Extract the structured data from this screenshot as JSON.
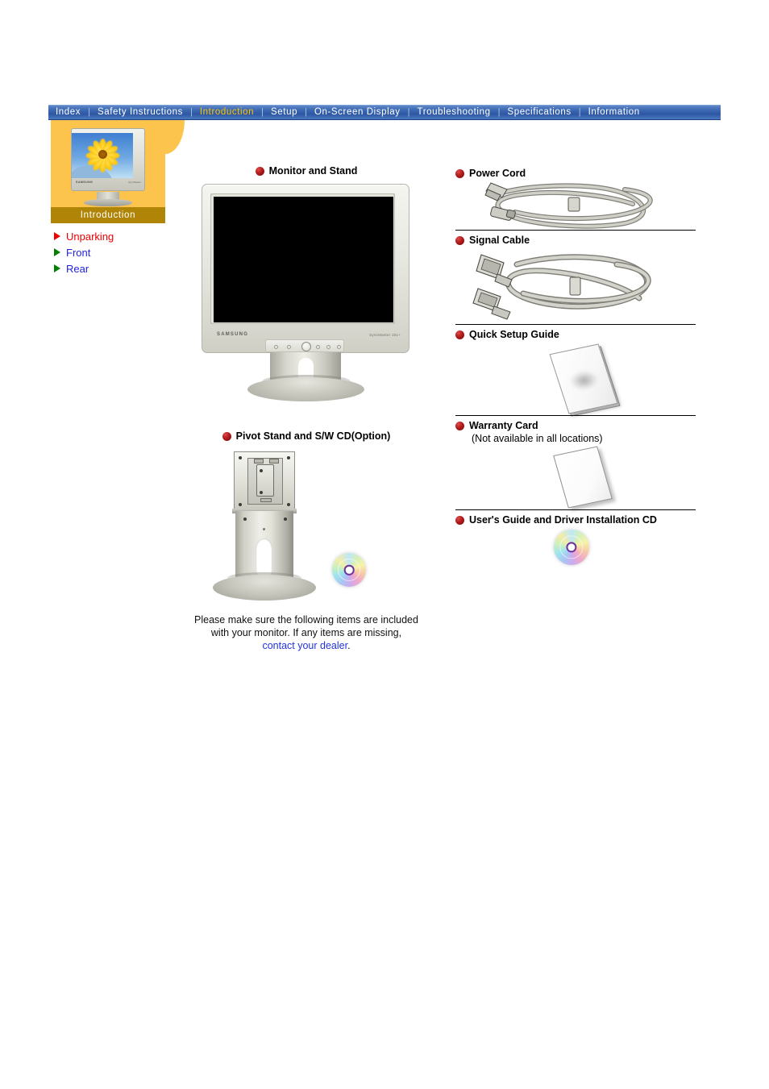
{
  "nav": {
    "separator": "|",
    "items": [
      {
        "label": "Index",
        "active": false
      },
      {
        "label": "Safety Instructions",
        "active": false
      },
      {
        "label": "Introduction",
        "active": true
      },
      {
        "label": "Setup",
        "active": false
      },
      {
        "label": "On-Screen Display",
        "active": false
      },
      {
        "label": "Troubleshooting",
        "active": false
      },
      {
        "label": "Specifications",
        "active": false
      },
      {
        "label": "Information",
        "active": false
      }
    ]
  },
  "sidebar": {
    "title": "Introduction",
    "thumbnail_logo": "SAMSUNG",
    "thumbnail_model": "SyncMaster",
    "items": [
      {
        "label": "Unparking",
        "active": true
      },
      {
        "label": "Front",
        "active": false
      },
      {
        "label": "Rear",
        "active": false
      }
    ]
  },
  "center": {
    "monitor": {
      "heading": "Monitor and Stand",
      "brand": "SAMSUNG",
      "model": "SyncMaster 151+"
    },
    "pivot": {
      "heading": "Pivot Stand and S/W CD(Option)"
    },
    "note": {
      "line1": "Please make sure the following items are included",
      "line2": "with your monitor. If any items are missing,",
      "link": "contact your dealer",
      "period": "."
    }
  },
  "packages": [
    {
      "heading": "Power Cord",
      "sub": "",
      "art": "power-cord"
    },
    {
      "heading": "Signal Cable",
      "sub": "",
      "art": "signal-cable"
    },
    {
      "heading": "Quick Setup Guide",
      "sub": "",
      "art": "booklet"
    },
    {
      "heading": "Warranty Card",
      "sub": "(Not available in all locations)",
      "art": "card"
    },
    {
      "heading": "User's Guide and Driver Installation CD",
      "sub": "",
      "art": "cd"
    }
  ],
  "colors": {
    "nav_bg": "#3f6cb4",
    "nav_active_text": "#ffc400",
    "sidebar_bg": "#fcc44d",
    "sidebar_title_bg": "#b08406",
    "active_link": "#ee0000",
    "link": "#2222dd",
    "bullet": "#b01b1b",
    "cable_gray": "#b9b9b1"
  }
}
